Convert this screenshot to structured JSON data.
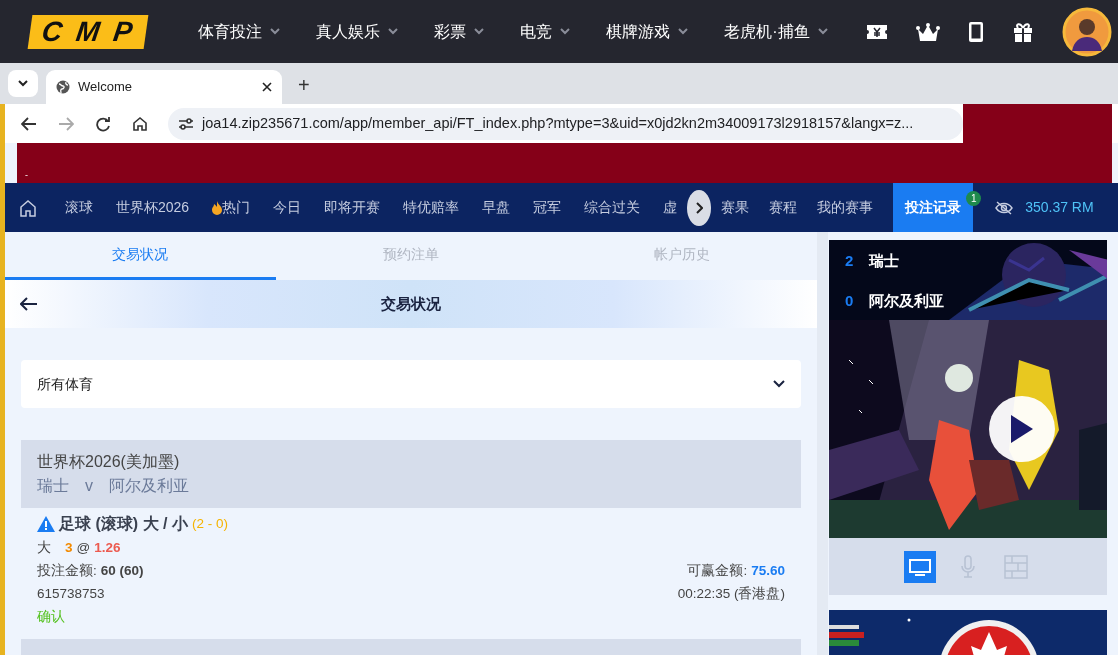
{
  "site_header": {
    "logo": "CMP",
    "menu": [
      {
        "label": "体育投注"
      },
      {
        "label": "真人娱乐"
      },
      {
        "label": "彩票"
      },
      {
        "label": "电竞"
      },
      {
        "label": "棋牌游戏"
      },
      {
        "label": "老虎机·捕鱼"
      }
    ]
  },
  "browser": {
    "tab_title": "Welcome",
    "new_tab": "+",
    "url": "joa14.zip235671.com/app/member_api/FT_index.php?mtype=3&uid=x0jd2kn2m34009173l2918157&langx=z...",
    "banner_text": "-"
  },
  "nav": {
    "items": [
      {
        "label": "滚球",
        "kind": "plain",
        "selected": false
      },
      {
        "label": "世界杯2026",
        "kind": "plain",
        "selected": false
      },
      {
        "label": "热门",
        "kind": "hot",
        "selected": false
      },
      {
        "label": "今日",
        "kind": "plain",
        "selected": false
      },
      {
        "label": "即将开赛",
        "kind": "plain",
        "selected": false
      },
      {
        "label": "特优赔率",
        "kind": "plain",
        "selected": false
      },
      {
        "label": "早盘",
        "kind": "plain",
        "selected": false
      },
      {
        "label": "冠军",
        "kind": "plain",
        "selected": false
      },
      {
        "label": "综合过关",
        "kind": "plain",
        "selected": false
      },
      {
        "label": "虚",
        "kind": "plain",
        "selected": false
      }
    ],
    "right_items": [
      {
        "label": "赛果",
        "selected": false
      },
      {
        "label": "赛程",
        "selected": false
      },
      {
        "label": "我的赛事",
        "selected": false
      },
      {
        "label": "投注记录",
        "selected": true,
        "badge": "1"
      }
    ],
    "balance": "350.37 RM"
  },
  "tabs": [
    {
      "label": "交易状况",
      "selected": true
    },
    {
      "label": "预约注单",
      "selected": false
    },
    {
      "label": "帐户历史",
      "selected": false
    }
  ],
  "page_title": "交易状况",
  "sport_filter": "所有体育",
  "bet": {
    "league": "世界杯2026(美加墨)",
    "home": "瑞士",
    "vs": "v",
    "away": "阿尔及利亚",
    "title": "足球 (滚球) 大 / 小",
    "score": "(2 - 0)",
    "selection": "大",
    "line": "3",
    "at": "@",
    "odds": "1.26",
    "stake_label": "投注金额:",
    "stake": "60 (60)",
    "win_label": "可赢金额:",
    "win": "75.60",
    "ticket": "615738753",
    "time": "00:22:35 (香港盘)",
    "status": "确认"
  },
  "scoreboard": [
    {
      "score": "2",
      "team": "瑞士"
    },
    {
      "score": "0",
      "team": "阿尔及利亚"
    }
  ],
  "media_buttons": [
    {
      "kind": "screen",
      "selected": true
    },
    {
      "kind": "mic",
      "selected": false
    },
    {
      "kind": "grid",
      "selected": false
    }
  ]
}
